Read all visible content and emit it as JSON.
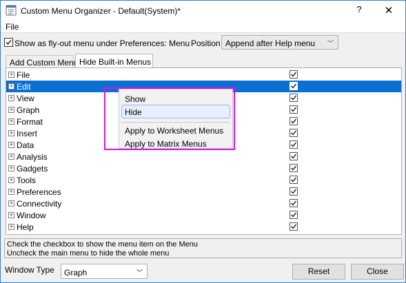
{
  "window": {
    "title": "Custom Menu Organizer - Default(System)*",
    "help_glyph": "?",
    "close_glyph": "✕"
  },
  "menubar": {
    "file": "File"
  },
  "options": {
    "flyout_label": "Show as fly-out menu under Preferences: Menu",
    "flyout_checked": true,
    "position_label": "Position",
    "position_value": "Append after Help menu"
  },
  "tabs": [
    {
      "label": "Add Custom Menu",
      "active": false
    },
    {
      "label": "Hide Built-in Menus",
      "active": true
    }
  ],
  "menus": [
    {
      "label": "File",
      "checked": true
    },
    {
      "label": "Edit",
      "checked": true,
      "selected": true
    },
    {
      "label": "View",
      "checked": true
    },
    {
      "label": "Graph",
      "checked": true
    },
    {
      "label": "Format",
      "checked": true
    },
    {
      "label": "Insert",
      "checked": true
    },
    {
      "label": "Data",
      "checked": true
    },
    {
      "label": "Analysis",
      "checked": true
    },
    {
      "label": "Gadgets",
      "checked": true
    },
    {
      "label": "Tools",
      "checked": true
    },
    {
      "label": "Preferences",
      "checked": true
    },
    {
      "label": "Connectivity",
      "checked": true
    },
    {
      "label": "Window",
      "checked": true
    },
    {
      "label": "Help",
      "checked": true
    }
  ],
  "context_menu": {
    "items": [
      {
        "label": "Show"
      },
      {
        "label": "Hide",
        "hover": true
      },
      {
        "label": "Apply to Worksheet Menus"
      },
      {
        "label": "Apply to Matrix Menus"
      }
    ]
  },
  "hint": {
    "line1": "Check the checkbox to show the menu item on the Menu",
    "line2": "Uncheck the main menu to hide the whole menu"
  },
  "bottom": {
    "window_type_label": "Window Type",
    "window_type_value": "Graph",
    "reset_label": "Reset",
    "close_label": "Close"
  },
  "colors": {
    "selection": "#0a6fd2",
    "highlight_outline": "#e010e0",
    "window_border": "#2f7fd6"
  }
}
